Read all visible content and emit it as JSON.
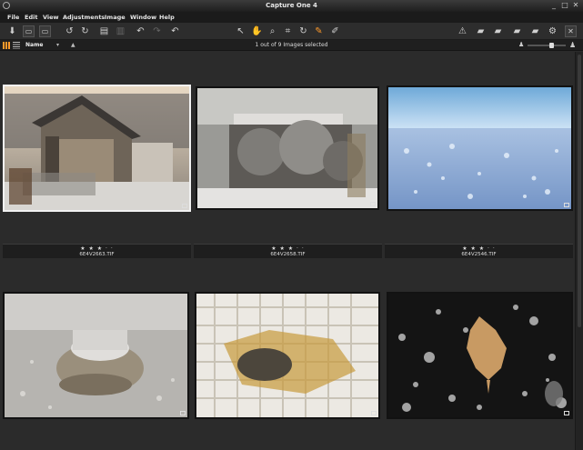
{
  "window": {
    "title": "Capture One 4",
    "minimize": "_",
    "maximize": "□",
    "close": "✕"
  },
  "menu": [
    "File",
    "Edit",
    "View",
    "Adjustments",
    "Image",
    "Window",
    "Help"
  ],
  "toolbar": {
    "left_icons": [
      "import-icon",
      "compare-icon",
      "compare-icon",
      "rotate-left-icon",
      "rotate-right-icon",
      "move-icon",
      "trash-icon",
      "undo-icon",
      "redo-icon",
      "history-icon"
    ],
    "cursor_icons": [
      "pointer-icon",
      "pan-icon",
      "zoom-icon",
      "crop-icon",
      "rotate-icon",
      "picker-icon",
      "color-icon"
    ],
    "right_icons": [
      "warning-icon",
      "folder-icon",
      "folder-icon",
      "print-icon",
      "export-icon",
      "settings-icon",
      "close-icon"
    ],
    "active_color": "#ff9a2b"
  },
  "viewbar": {
    "sort_label": "Name",
    "sort_dropdown": "▾",
    "sort_direction": "▲",
    "status": "1 out of 9 Images selected"
  },
  "browser": {
    "rating_text": "★ ★ ★ · ·",
    "items": [
      {
        "filename": "6E4V2663.TIF",
        "selected": true
      },
      {
        "filename": "6E4V2658.TIF",
        "selected": false
      },
      {
        "filename": "6E4V2546.TIF",
        "selected": false
      },
      {
        "filename": "",
        "selected": false
      },
      {
        "filename": "",
        "selected": false
      },
      {
        "filename": "",
        "selected": false
      }
    ]
  },
  "colors": {
    "selection_border": "#f2f2f2",
    "background": "#2b2b2b"
  }
}
